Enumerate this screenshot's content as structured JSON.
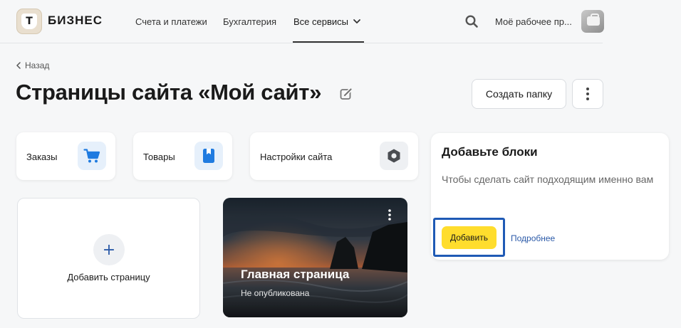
{
  "header": {
    "logo_letter": "Т",
    "brand": "БИЗНЕС",
    "nav": [
      {
        "label": "Счета и платежи"
      },
      {
        "label": "Бухгалтерия"
      },
      {
        "label": "Все сервисы"
      }
    ],
    "workspace_label": "Моё рабочее пр..."
  },
  "page": {
    "back_label": "Назад",
    "title": "Страницы сайта «Мой сайт»",
    "create_folder_label": "Создать папку"
  },
  "quick_cards": [
    {
      "label": "Заказы",
      "icon": "cart-icon"
    },
    {
      "label": "Товары",
      "icon": "bookmark-icon"
    },
    {
      "label": "Настройки сайта",
      "icon": "gear-icon"
    }
  ],
  "pages": {
    "add_page_label": "Добавить страницу",
    "home": {
      "title": "Главная страница",
      "status": "Не опубликована"
    }
  },
  "promo": {
    "title": "Добавьте блоки",
    "text": "Чтобы сделать сайт подходящим именно вам",
    "add_label": "Добавить",
    "more_label": "Подробнее"
  },
  "colors": {
    "accent_yellow": "#ffdd2d",
    "link_blue": "#2b5aa8",
    "highlight_blue": "#1f5ab5",
    "icon_bg_blue": "#e6f0fb",
    "icon_blue": "#1f7be0"
  }
}
